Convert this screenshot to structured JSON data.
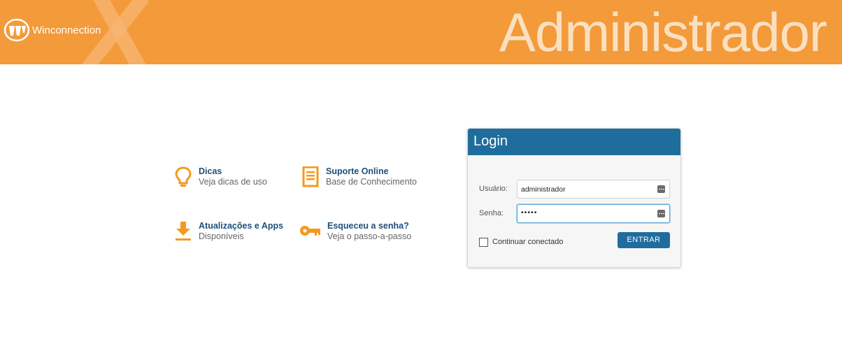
{
  "header": {
    "brand": "Winconnection",
    "title": "Administrador",
    "bg_color": "#f39a3a"
  },
  "links": [
    {
      "title": "Dicas",
      "subtitle": "Veja dicas de uso",
      "icon": "lightbulb-icon"
    },
    {
      "title": "Suporte Online",
      "subtitle": "Base de Conhecimento",
      "icon": "document-icon"
    },
    {
      "title": "Atualizações e Apps",
      "subtitle": "Disponíveis",
      "icon": "download-icon"
    },
    {
      "title": "Esqueceu a senha?",
      "subtitle": "Veja o passo-a-passo",
      "icon": "key-icon"
    }
  ],
  "login": {
    "title": "Login",
    "username_label": "Usuário:",
    "username_value": "administrador",
    "password_label": "Senha:",
    "password_value": "•••••",
    "remember_label": "Continuar conectado",
    "remember_checked": false,
    "submit_label": "ENTRAR",
    "accent_color": "#1f6d9c"
  }
}
